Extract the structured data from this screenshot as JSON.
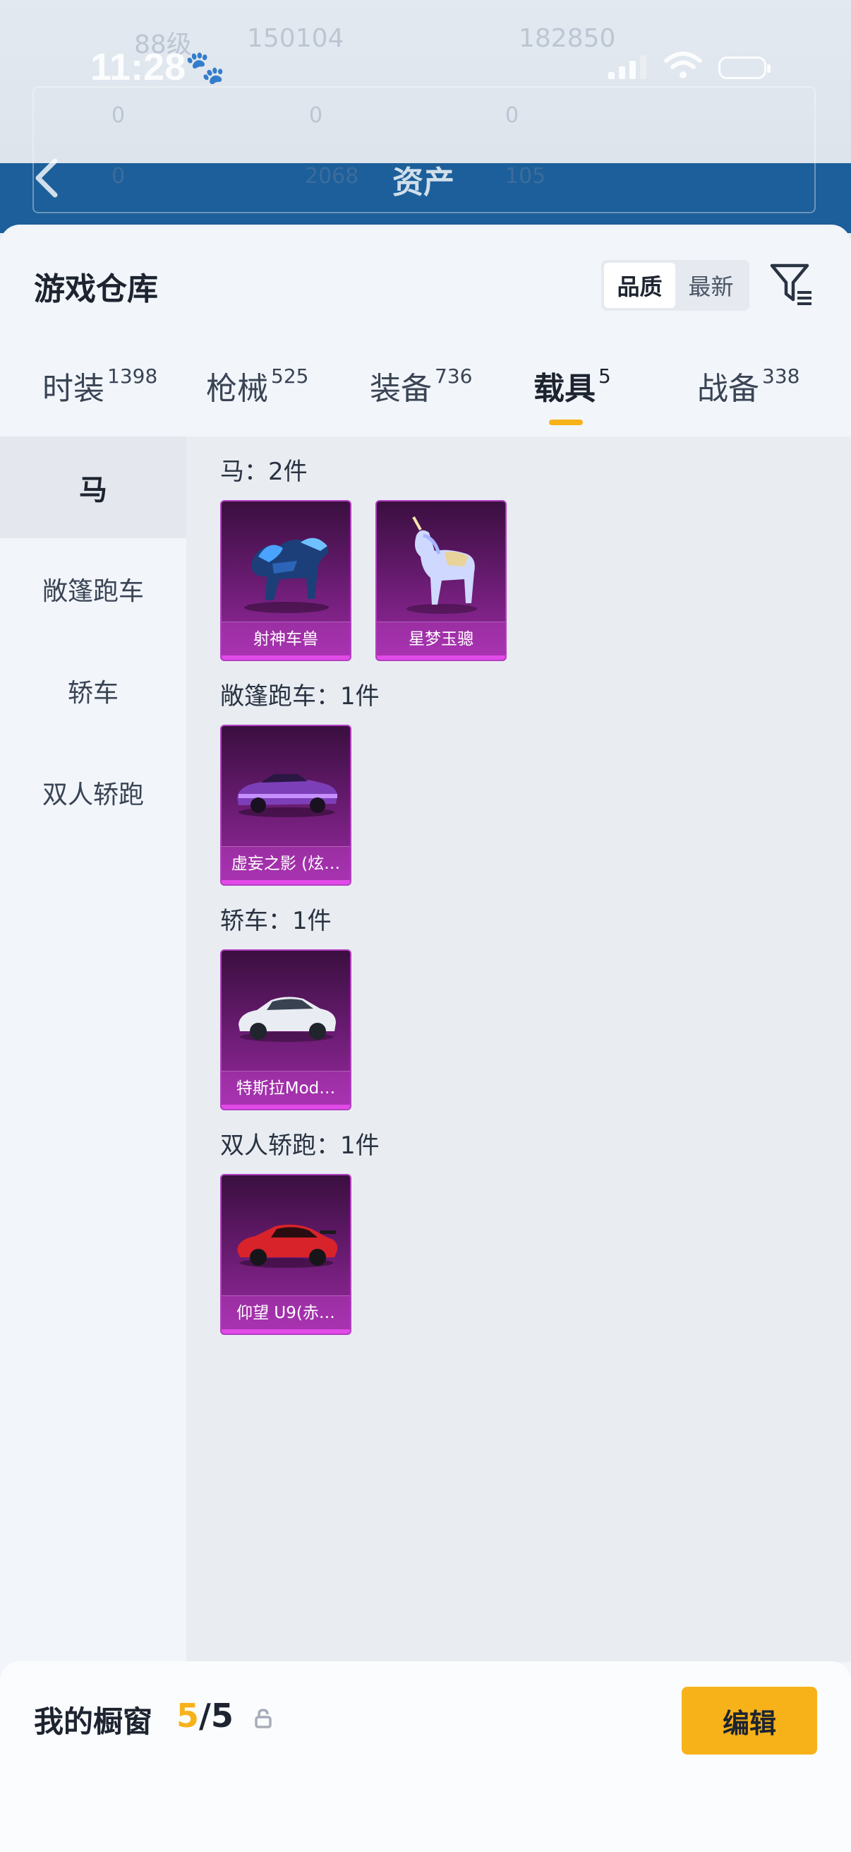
{
  "status_bar": {
    "time": "11:28"
  },
  "background": {
    "level_text": "88级",
    "stat_1": "150104",
    "stat_2": "182850",
    "row_values": [
      "0",
      "0",
      "0",
      "0",
      "2068",
      "105"
    ],
    "title": "资产"
  },
  "header": {
    "title": "游戏仓库",
    "sort_options": [
      "品质",
      "最新"
    ],
    "sort_active": "品质"
  },
  "tabs": [
    {
      "label": "时装",
      "count": "1398"
    },
    {
      "label": "枪械",
      "count": "525"
    },
    {
      "label": "装备",
      "count": "736"
    },
    {
      "label": "载具",
      "count": "5",
      "active": true
    },
    {
      "label": "战备",
      "count": "338"
    }
  ],
  "sidebar": {
    "items": [
      "马",
      "敞篷跑车",
      "轿车",
      "双人轿跑"
    ],
    "active": "马"
  },
  "groups": [
    {
      "title": "马：2件",
      "items": [
        "射神车兽",
        "星梦玉骢"
      ]
    },
    {
      "title": "敞篷跑车：1件",
      "items": [
        "虚妄之影 (炫…"
      ]
    },
    {
      "title": "轿车：1件",
      "items": [
        "特斯拉Mod…"
      ]
    },
    {
      "title": "双人轿跑：1件",
      "items": [
        "仰望 U9(赤…"
      ]
    }
  ],
  "bottom_bar": {
    "label": "我的橱窗",
    "count_current": "5",
    "count_sep_total": "/5",
    "edit_label": "编辑"
  },
  "colors": {
    "accent": "#f7b21a",
    "card_purple": "#641a6c",
    "sheet_bg": "#f2f6fb",
    "content_bg": "#e9edf2"
  }
}
